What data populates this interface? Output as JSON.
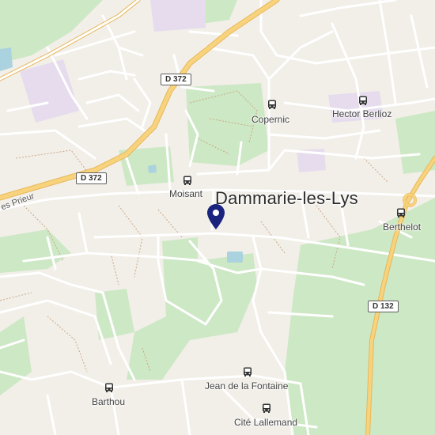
{
  "map": {
    "colors": {
      "background": "#f2efe9",
      "park": "#cde8c4",
      "road": "#ffffff",
      "major_road": "#f7d37d",
      "path": "#c9a888",
      "water": "#aad3df",
      "campus": "#e6dced",
      "pin": "#1a237e"
    },
    "city_label": "Dammarie-les-Lys",
    "road_shields": {
      "d372_top": "D 372",
      "d372_left": "D 372",
      "d132": "D 132"
    },
    "street_label": "es Prieur",
    "bus_stops": [
      {
        "label": "Copernic",
        "icon": "bus-icon"
      },
      {
        "label": "Hector Berlioz",
        "icon": "bus-icon"
      },
      {
        "label": "Moisant",
        "icon": "bus-icon"
      },
      {
        "label": "Berthelot",
        "icon": "bus-icon"
      },
      {
        "label": "Jean de la Fontaine",
        "icon": "bus-icon"
      },
      {
        "label": "Barthou",
        "icon": "bus-icon"
      },
      {
        "label": "Cité Lallemand",
        "icon": "bus-icon"
      }
    ],
    "marker": {
      "icon": "location-pin-icon"
    }
  }
}
